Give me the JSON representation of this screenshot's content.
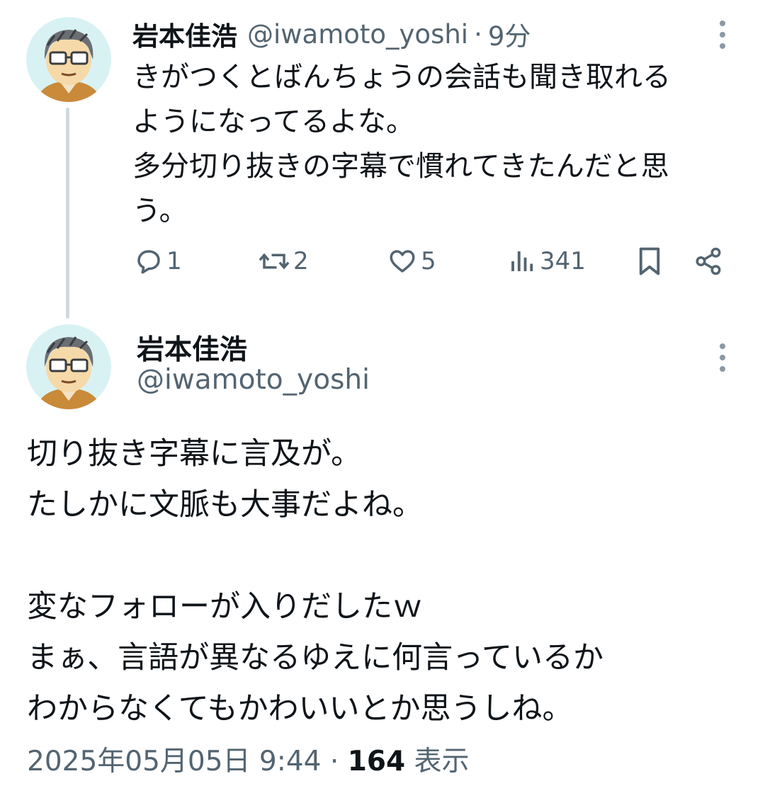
{
  "reply_tweet": {
    "author_name": "岩本佳浩",
    "handle": "@iwamoto_yoshi",
    "separator": "·",
    "time_ago": "9分",
    "text": "きがつくとばんちょうの会話も聞き取れる\nようになってるよな。\n多分切り抜きの字幕で慣れてきたんだと思\nう。",
    "actions": {
      "replies": "1",
      "retweets": "2",
      "likes": "5",
      "views": "341"
    }
  },
  "main_tweet": {
    "author_name": "岩本佳浩",
    "handle": "@iwamoto_yoshi",
    "text": "切り抜き字幕に言及が。\nたしかに文脈も大事だよね。\n\n変なフォローが入りだしたｗ\nまぁ、言語が異なるゆえに何言っているか\nわからなくてもかわいいとか思うしね。",
    "timestamp": "2025年05月05日 9:44",
    "separator": "·",
    "views_count": "164",
    "views_label": "表示"
  },
  "icons": {
    "more": "more-vertical-icon",
    "reply": "reply-icon",
    "retweet": "retweet-icon",
    "like": "heart-icon",
    "views": "analytics-icon",
    "bookmark": "bookmark-icon",
    "share": "share-icon"
  },
  "colors": {
    "text_primary": "#0f1419",
    "text_secondary": "#536471",
    "thread_line": "#cfd9de",
    "avatar_bg": "#d8f2f4"
  }
}
